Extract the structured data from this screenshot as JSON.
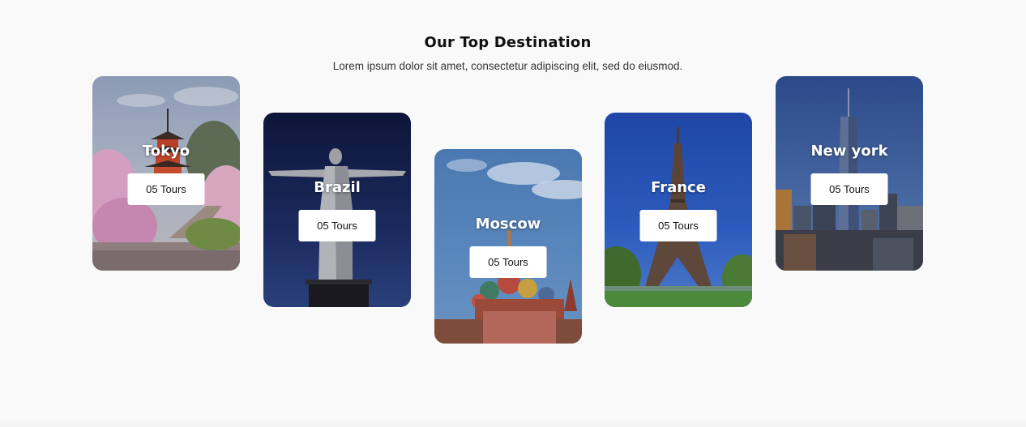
{
  "section": {
    "title": "Our Top Destination",
    "subtitle": "Lorem ipsum dolor sit amet, consectetur adipiscing elit, sed do eiusmod."
  },
  "destinations": [
    {
      "name": "Tokyo",
      "tours_label": "05 Tours",
      "image": "tokyo-pagoda-cherry-blossom"
    },
    {
      "name": "Brazil",
      "tours_label": "05 Tours",
      "image": "christ-the-redeemer-statue"
    },
    {
      "name": "Moscow",
      "tours_label": "05 Tours",
      "image": "saint-basils-cathedral"
    },
    {
      "name": "France",
      "tours_label": "05 Tours",
      "image": "eiffel-tower"
    },
    {
      "name": "New york",
      "tours_label": "05 Tours",
      "image": "new-york-skyline"
    }
  ]
}
